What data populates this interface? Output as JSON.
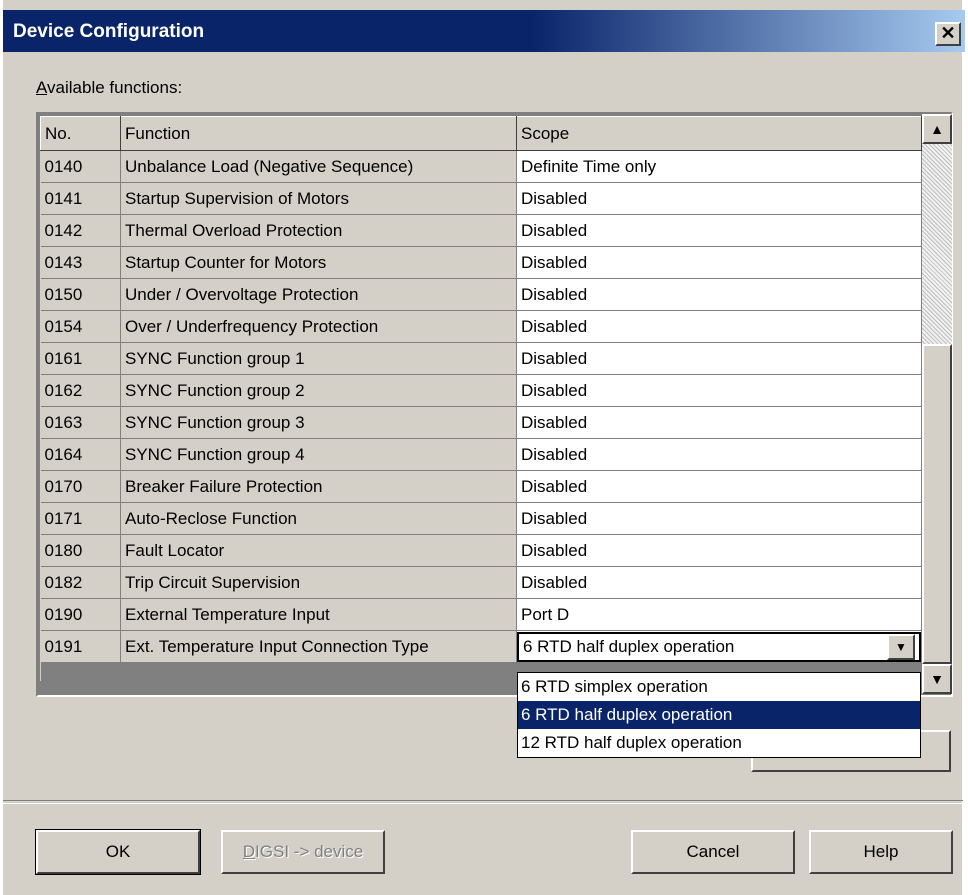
{
  "window": {
    "title": "Device Configuration",
    "close_glyph": "✕"
  },
  "available_label": "Available functions:",
  "columns": {
    "no": "No.",
    "function": "Function",
    "scope": "Scope"
  },
  "rows": [
    {
      "no": "0140",
      "function": "Unbalance Load (Negative Sequence)",
      "scope": "Definite Time only"
    },
    {
      "no": "0141",
      "function": "Startup Supervision of Motors",
      "scope": "Disabled"
    },
    {
      "no": "0142",
      "function": "Thermal Overload Protection",
      "scope": "Disabled"
    },
    {
      "no": "0143",
      "function": "Startup Counter for Motors",
      "scope": "Disabled"
    },
    {
      "no": "0150",
      "function": "Under / Overvoltage Protection",
      "scope": "Disabled"
    },
    {
      "no": "0154",
      "function": "Over / Underfrequency Protection",
      "scope": "Disabled"
    },
    {
      "no": "0161",
      "function": "SYNC Function group 1",
      "scope": "Disabled"
    },
    {
      "no": "0162",
      "function": "SYNC Function group 2",
      "scope": "Disabled"
    },
    {
      "no": "0163",
      "function": "SYNC Function group 3",
      "scope": "Disabled"
    },
    {
      "no": "0164",
      "function": "SYNC Function group 4",
      "scope": "Disabled"
    },
    {
      "no": "0170",
      "function": "Breaker Failure Protection",
      "scope": "Disabled"
    },
    {
      "no": "0171",
      "function": "Auto-Reclose Function",
      "scope": "Disabled"
    },
    {
      "no": "0180",
      "function": "Fault Locator",
      "scope": "Disabled"
    },
    {
      "no": "0182",
      "function": "Trip Circuit Supervision",
      "scope": "Disabled"
    },
    {
      "no": "0190",
      "function": "External Temperature Input",
      "scope": "Port D"
    }
  ],
  "active_row": {
    "no": "0191",
    "function": "Ext. Temperature Input Connection Type",
    "scope": "6 RTD half duplex operation"
  },
  "dropdown_options": [
    "6 RTD simplex operation",
    "6 RTD half duplex operation",
    "12 RTD half duplex operation"
  ],
  "dropdown_selected_index": 1,
  "buttons": {
    "ok": "OK",
    "digsi": "DIGSI -> device",
    "cancel": "Cancel",
    "help": "Help"
  },
  "icons": {
    "scroll_up": "triangle-up-icon",
    "scroll_down": "triangle-down-icon",
    "combo_arrow": "triangle-down-icon"
  }
}
